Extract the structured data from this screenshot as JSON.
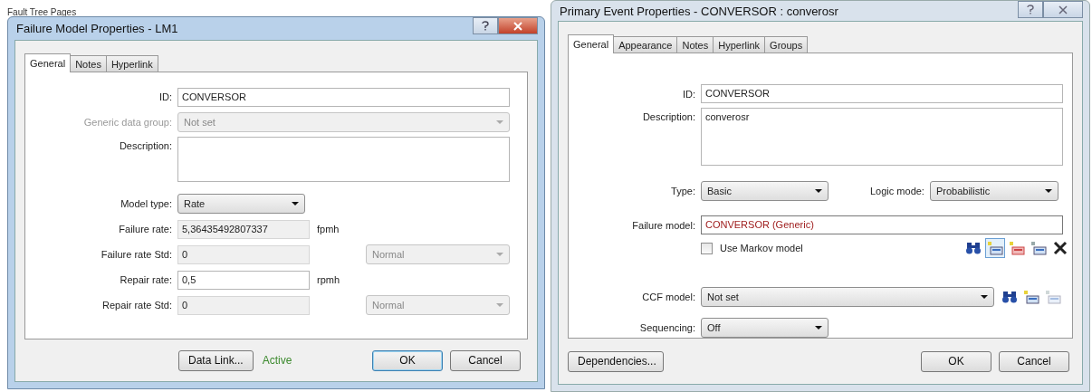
{
  "background": {
    "label": "Fault Tree Pages"
  },
  "left": {
    "title": "Failure Model Properties - LM1",
    "tabs": [
      {
        "label": "General",
        "selected": true
      },
      {
        "label": "Notes",
        "selected": false
      },
      {
        "label": "Hyperlink",
        "selected": false
      }
    ],
    "rows": [
      {
        "label": "ID:",
        "kind": "text",
        "value": "CONVERSOR",
        "disabled": false
      },
      {
        "label": "Generic data group:",
        "kind": "select",
        "value": "Not set",
        "disabled": true
      },
      {
        "label": "Description:",
        "kind": "memo",
        "value": "",
        "disabled": false
      },
      {
        "label": "Model type:",
        "kind": "select-short",
        "value": "Rate",
        "disabled": false
      },
      {
        "label": "Failure rate:",
        "kind": "number",
        "value": "5,36435492807337",
        "disabled": true,
        "unit": "fpmh"
      },
      {
        "label": "Failure rate Std:",
        "kind": "number",
        "value": "0",
        "disabled": true,
        "distribution": "Normal"
      },
      {
        "label": "Repair rate:",
        "kind": "number",
        "value": "0,5",
        "disabled": false,
        "unit": "rpmh"
      },
      {
        "label": "Repair rate Std:",
        "kind": "number",
        "value": "0",
        "disabled": true,
        "distribution": "Normal"
      }
    ],
    "data_link": "Data Link...",
    "link_status": "Active",
    "ok": "OK",
    "cancel": "Cancel"
  },
  "right": {
    "title": "Primary Event Properties - CONVERSOR : converosr",
    "tabs": [
      {
        "label": "General",
        "selected": true
      },
      {
        "label": "Appearance",
        "selected": false
      },
      {
        "label": "Notes",
        "selected": false
      },
      {
        "label": "Hyperlink",
        "selected": false
      },
      {
        "label": "Groups",
        "selected": false
      }
    ],
    "id": {
      "label": "ID:",
      "value": "CONVERSOR"
    },
    "description": {
      "label": "Description:",
      "value": "converosr"
    },
    "type": {
      "label": "Type:",
      "value": "Basic"
    },
    "logic_mode": {
      "label": "Logic mode:",
      "value": "Probabilistic"
    },
    "failure_model": {
      "label": "Failure model:",
      "value": "CONVERSOR (Generic)"
    },
    "markov": {
      "label": "Use Markov model",
      "checked": false
    },
    "failure_tools": [
      {
        "kind": "find",
        "selected": false,
        "disabled": false
      },
      {
        "kind": "new",
        "selected": true,
        "disabled": false
      },
      {
        "kind": "edit",
        "selected": false,
        "disabled": false
      },
      {
        "kind": "copy",
        "selected": false,
        "disabled": false
      },
      {
        "kind": "delete",
        "selected": false,
        "disabled": false
      }
    ],
    "ccf_model": {
      "label": "CCF model:",
      "value": "Not set"
    },
    "ccf_tools": [
      {
        "kind": "find",
        "selected": false,
        "disabled": false
      },
      {
        "kind": "new",
        "selected": false,
        "disabled": false
      },
      {
        "kind": "copy",
        "selected": false,
        "disabled": true
      }
    ],
    "sequencing": {
      "label": "Sequencing:",
      "value": "Off"
    },
    "dependencies": "Dependencies...",
    "ok": "OK",
    "cancel": "Cancel"
  }
}
